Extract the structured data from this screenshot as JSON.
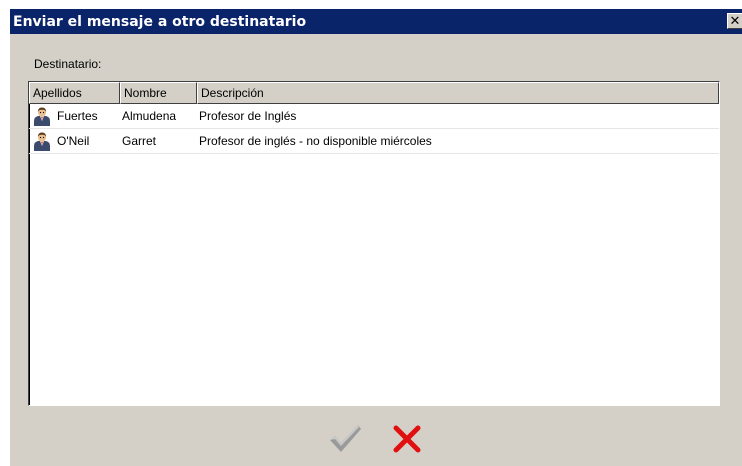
{
  "window": {
    "title": "Enviar el mensaje a otro destinatario",
    "close_glyph": "✕"
  },
  "form": {
    "recipient_label": "Destinatario:"
  },
  "table": {
    "columns": [
      "Apellidos",
      "Nombre",
      "Descripción"
    ],
    "rows": [
      {
        "icon": "person-icon",
        "apellidos": "Fuertes",
        "nombre": "Almudena",
        "descripcion": "Profesor de Inglés"
      },
      {
        "icon": "person-icon",
        "apellidos": "O'Neil",
        "nombre": "Garret",
        "descripcion": "Profesor de inglés - no disponible miércoles"
      }
    ]
  },
  "actions": {
    "confirm_icon": "checkmark-icon",
    "cancel_icon": "x-icon",
    "confirm_color": "#9a9a9a",
    "cancel_color": "#e01010"
  },
  "colors": {
    "titlebar": "#0a246a",
    "dialog_bg": "#d4d0c8"
  }
}
